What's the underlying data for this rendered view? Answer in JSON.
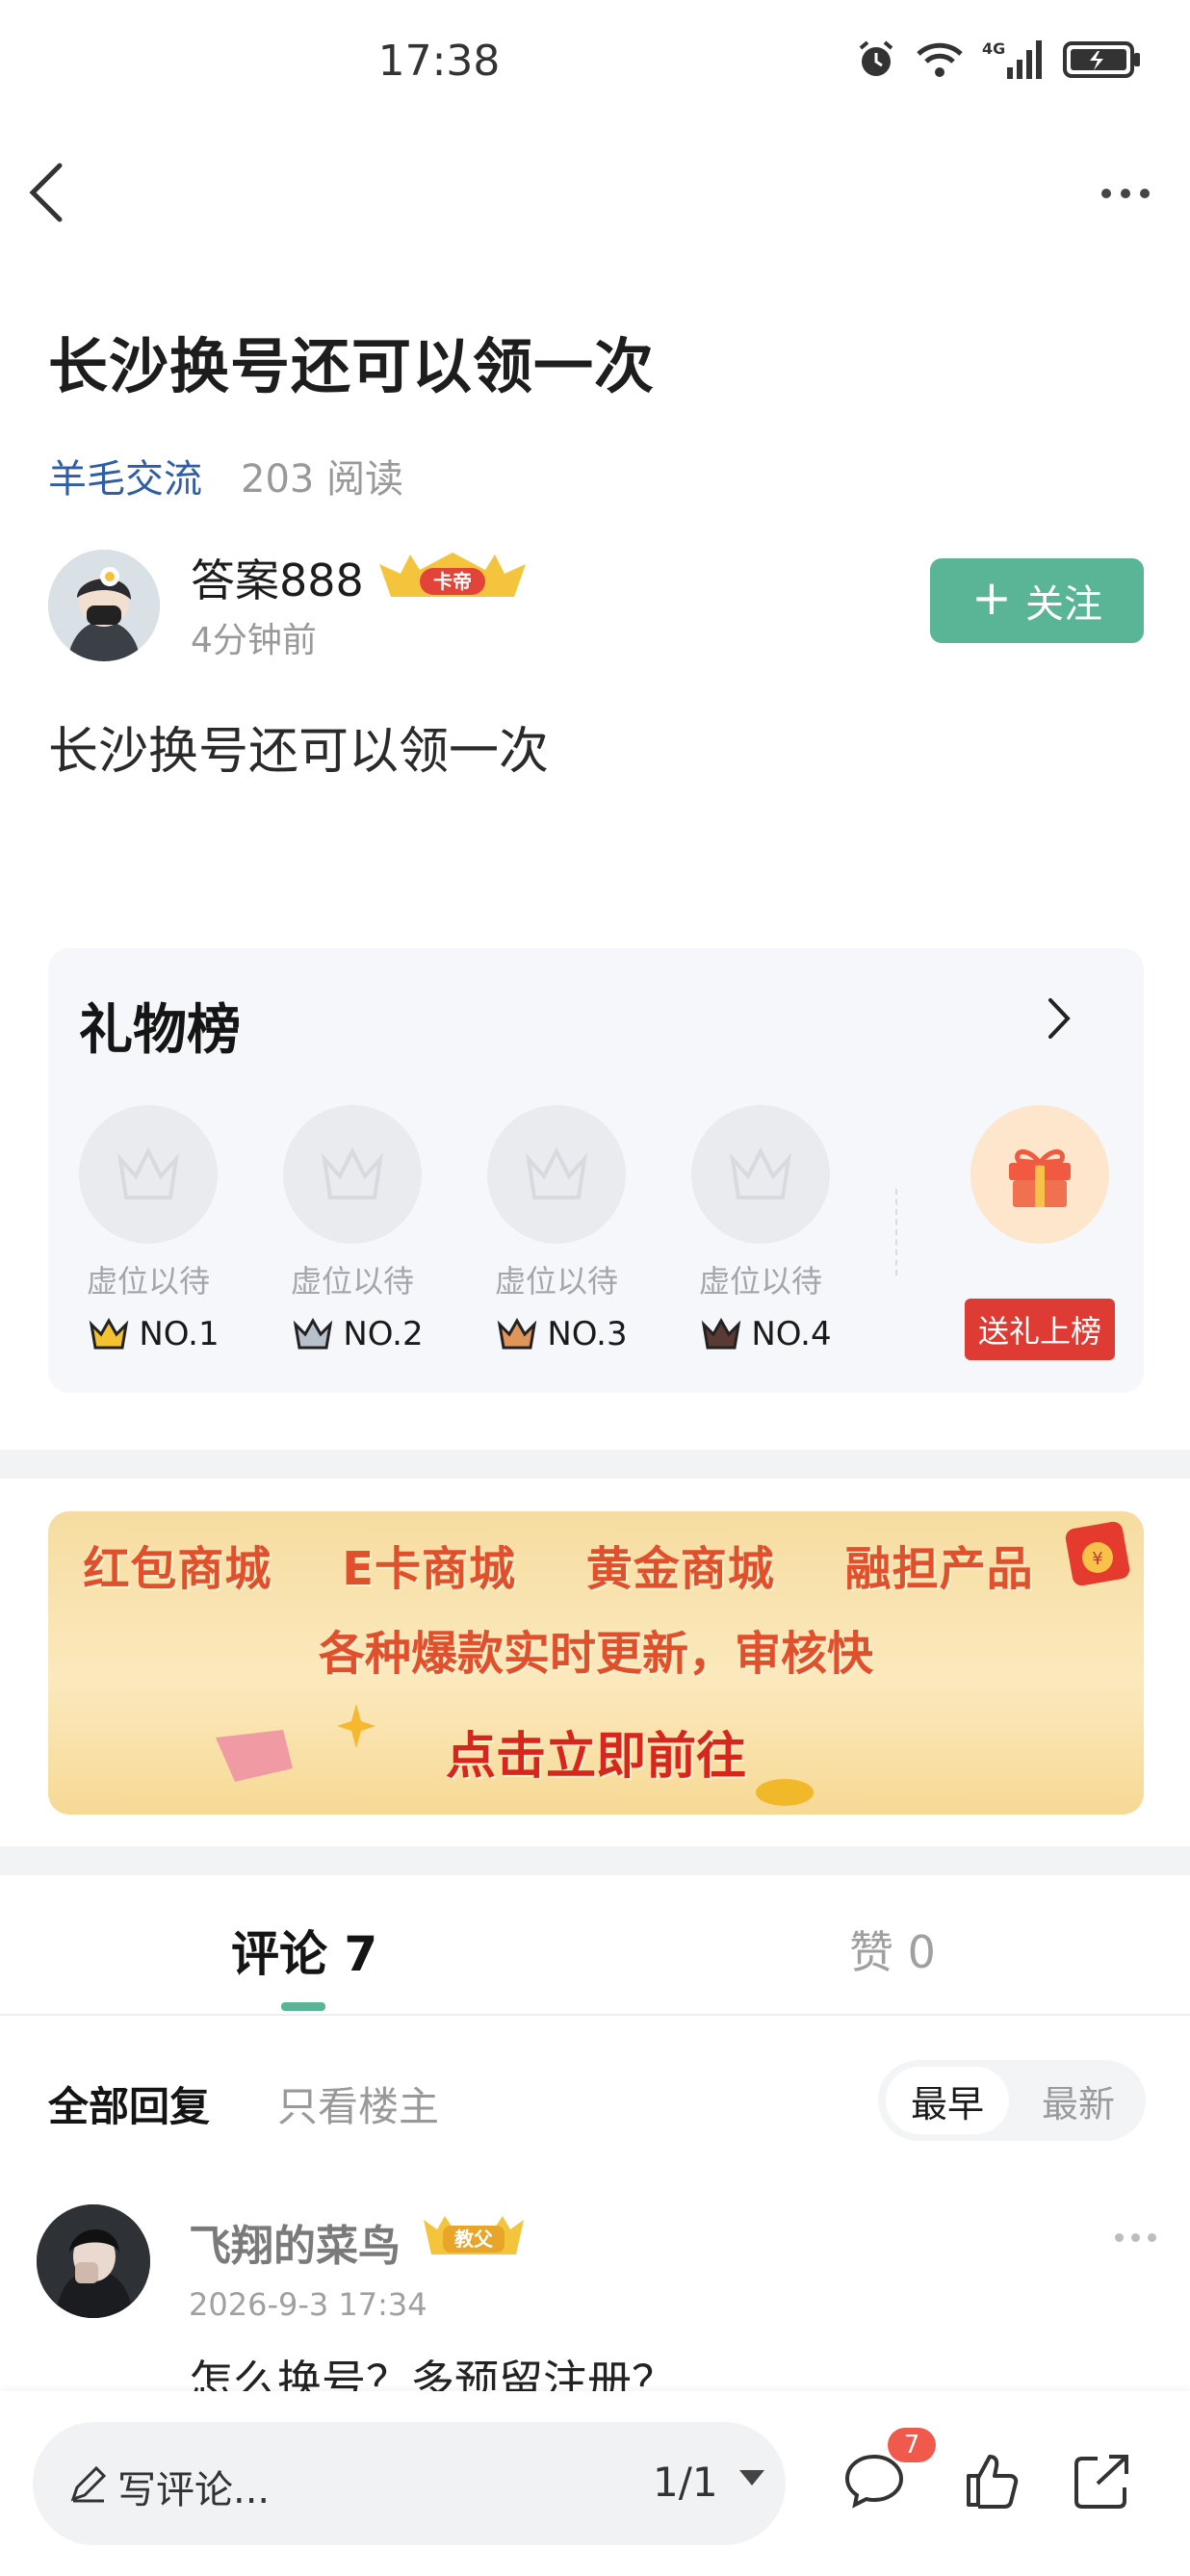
{
  "status_bar": {
    "time": "17:38",
    "network": "4G"
  },
  "nav": {
    "back_icon": "back-chevron-icon",
    "more_icon": "more-dots-icon"
  },
  "post": {
    "title": "长沙换号还可以领一次",
    "category": "羊毛交流",
    "read_count": "203 阅读",
    "author": {
      "name": "答案888",
      "badge": "卡帝",
      "time": "4分钟前"
    },
    "follow_label": "关注",
    "body": "长沙换号还可以领一次"
  },
  "gift_board": {
    "title": "礼物榜",
    "slots": [
      {
        "label": "虚位以待",
        "rank": "NO.1",
        "crown_color": "#f2c230"
      },
      {
        "label": "虚位以待",
        "rank": "NO.2",
        "crown_color": "#b8c0cc"
      },
      {
        "label": "虚位以待",
        "rank": "NO.3",
        "crown_color": "#e0955a"
      },
      {
        "label": "虚位以待",
        "rank": "NO.4",
        "crown_color": "#5a3b33"
      }
    ],
    "send_label": "送礼上榜"
  },
  "banner": {
    "items": [
      "红包商城",
      "E卡商城",
      "黄金商城",
      "融担产品"
    ],
    "line2": "各种爆款实时更新，审核快",
    "line3": "点击立即前往"
  },
  "tabs": {
    "comments": "评论 7",
    "likes": "赞 0"
  },
  "filters": {
    "all": "全部回复",
    "op_only": "只看楼主",
    "sort_earliest": "最早",
    "sort_latest": "最新"
  },
  "comment": {
    "name": "飞翔的菜鸟",
    "badge": "教父",
    "time": "2026-9-3 17:34",
    "text": "怎么换号？多预留注册？"
  },
  "bottom_bar": {
    "input_placeholder": "写评论...",
    "page_indicator": "1/1",
    "comment_count": "7"
  },
  "colors": {
    "accent": "#59b596",
    "link": "#2f5ea4",
    "danger": "#dd3b33"
  }
}
